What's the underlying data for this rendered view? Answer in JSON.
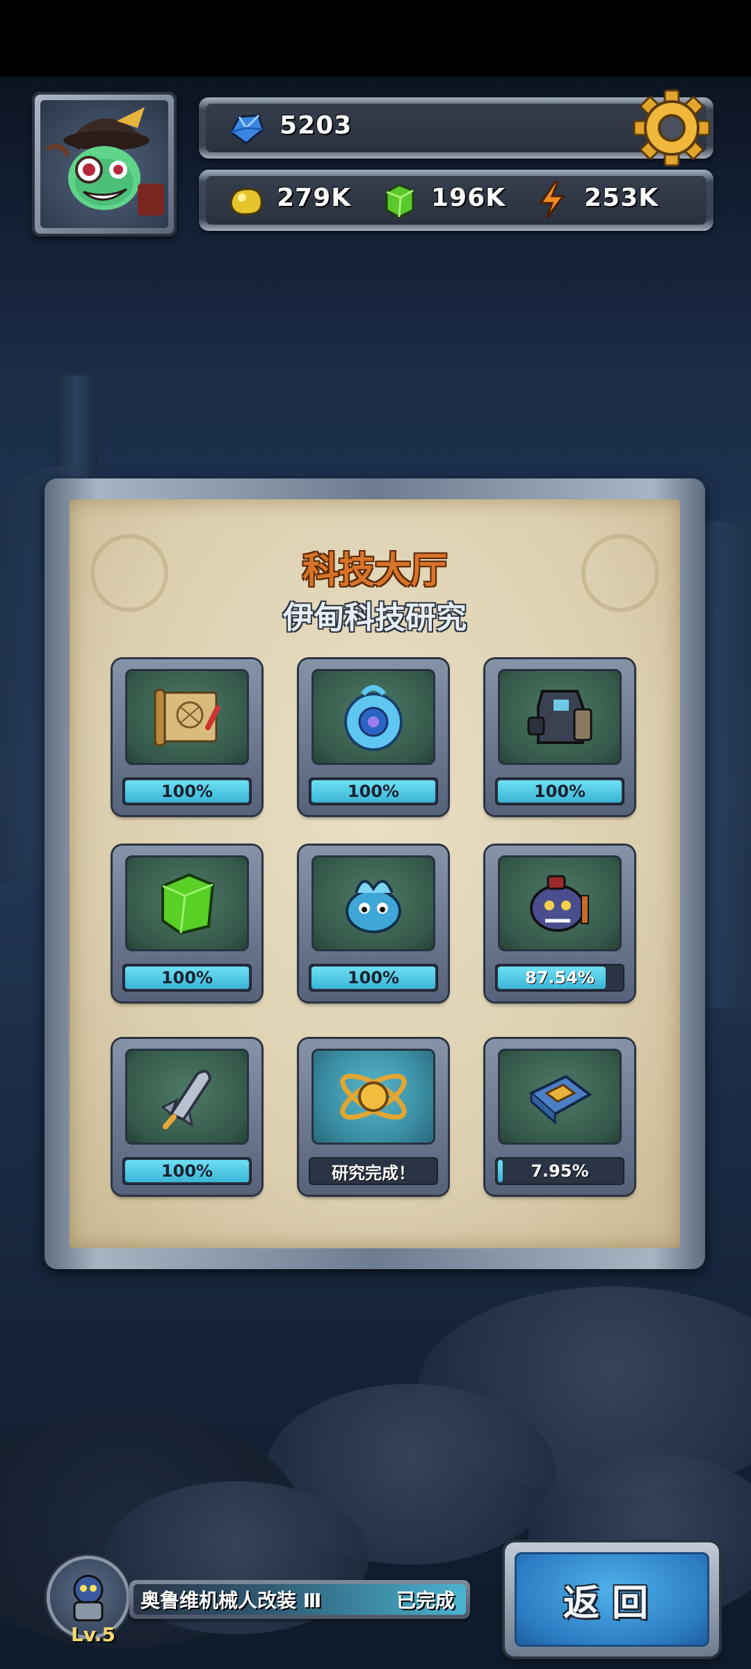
{
  "hud": {
    "gems": "5203",
    "gold": "279K",
    "crystal": "196K",
    "energy": "253K"
  },
  "panel": {
    "title": "科技大厅",
    "subtitle": "伊甸科技研究"
  },
  "research": [
    {
      "icon": "map-scroll-icon",
      "label": "100%",
      "progress": 1.0
    },
    {
      "icon": "blue-orb-icon",
      "label": "100%",
      "progress": 1.0
    },
    {
      "icon": "robot-armor-icon",
      "label": "100%",
      "progress": 1.0
    },
    {
      "icon": "green-crystal-icon",
      "label": "100%",
      "progress": 1.0
    },
    {
      "icon": "blue-slime-icon",
      "label": "100%",
      "progress": 1.0
    },
    {
      "icon": "purple-monster-icon",
      "label": "87.54%",
      "progress": 0.8754
    },
    {
      "icon": "rocket-ship-icon",
      "label": "100%",
      "progress": 1.0
    },
    {
      "icon": "atom-icon",
      "label": "研究完成！",
      "progress": 1.0
    },
    {
      "icon": "chip-card-icon",
      "label": "7.95%",
      "progress": 0.0795
    }
  ],
  "quest": {
    "name": "奥鲁维机械人改装 Ⅲ",
    "status": "已完成",
    "level": "Lv.5"
  },
  "back_button": "返回",
  "colors": {
    "title_orange": "#d8742a",
    "progress_cyan": "#3ab5d6",
    "back_blue": "#2c7dc4"
  }
}
